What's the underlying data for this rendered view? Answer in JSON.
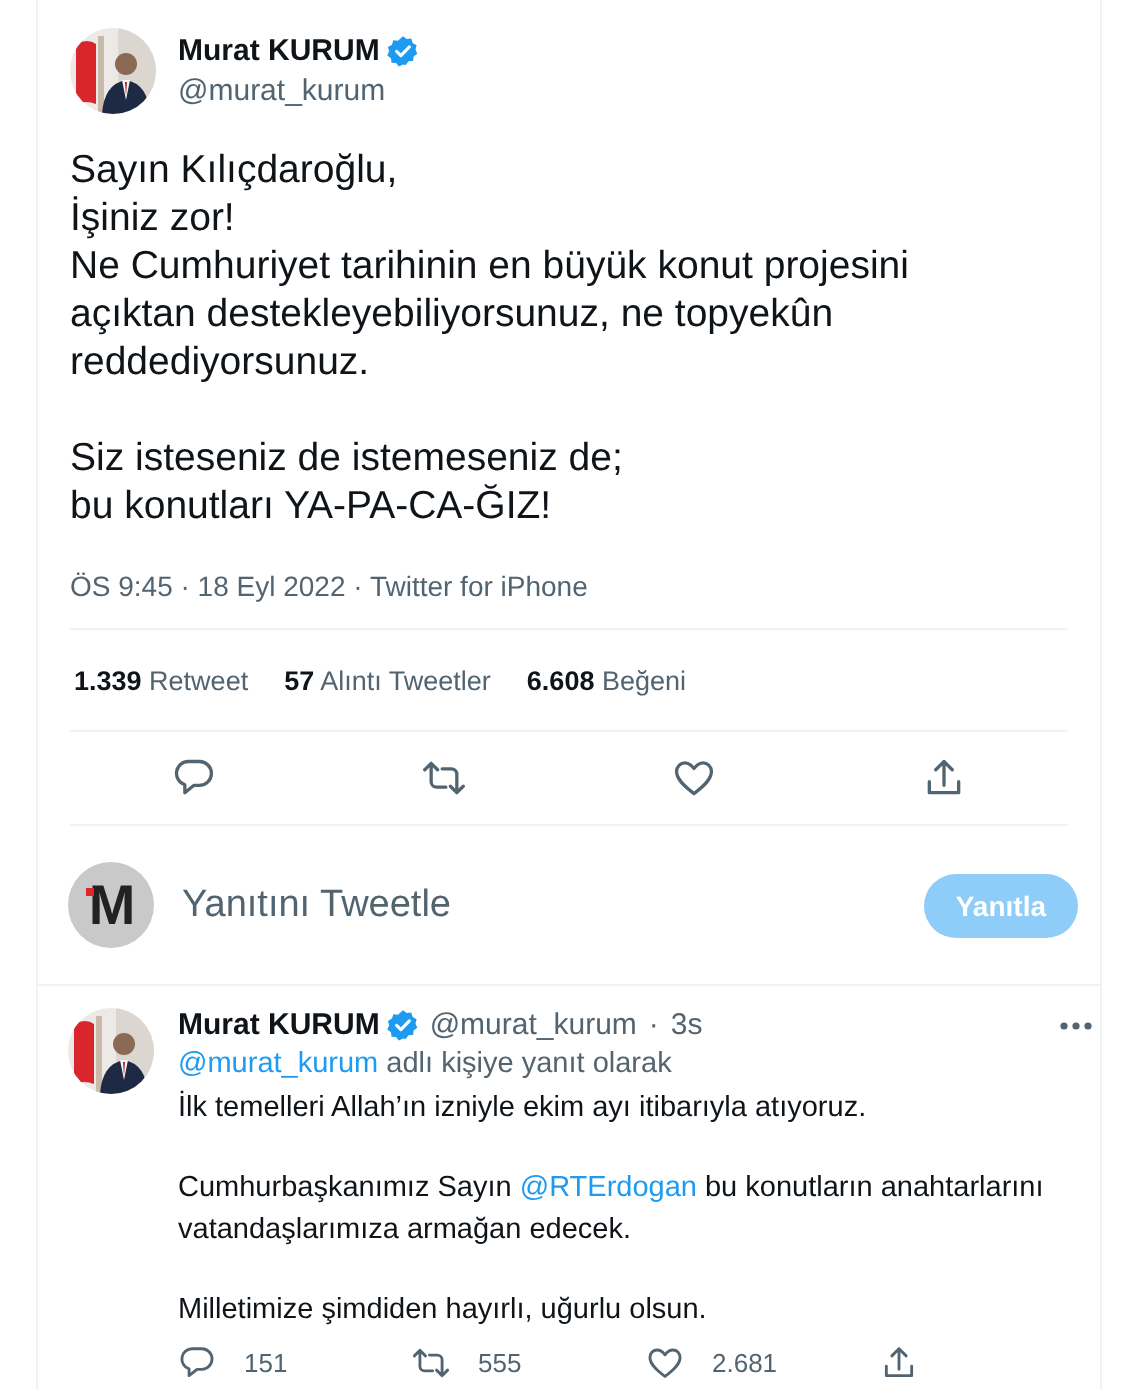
{
  "tweet": {
    "author": {
      "name": "Murat KURUM",
      "handle": "@murat_kurum",
      "verified": true
    },
    "text": "Sayın Kılıçdaroğlu,\nİşiniz zor!\nNe Cumhuriyet tarihinin en büyük konut projesini\naçıktan destekleyebiliyorsunuz, ne topyekûn\nreddediyorsunuz.\n\nSiz isteseniz de istemeseniz de;\nbu konutları YA-PA-CA-ĞIZ!",
    "meta": "ÖS 9:45 · 18 Eyl 2022 · Twitter for iPhone",
    "stats": [
      {
        "count": "1.339",
        "label": "Retweet"
      },
      {
        "count": "57",
        "label": "Alıntı Tweetler"
      },
      {
        "count": "6.608",
        "label": "Beğeni"
      }
    ],
    "actions": [
      {
        "kind": "reply"
      },
      {
        "kind": "retweet"
      },
      {
        "kind": "like"
      },
      {
        "kind": "share"
      }
    ]
  },
  "compose": {
    "logo": "M",
    "placeholder": "Yanıtını Tweetle",
    "button": {
      "label": "Yanıtla",
      "disabled": true
    }
  },
  "reply": {
    "author": {
      "name": "Murat KURUM",
      "handle": "@murat_kurum",
      "verified": true,
      "separator": "·",
      "time": "3s"
    },
    "reply_to": {
      "mention": "@murat_kurum",
      "text": "adlı kişiye yanıt olarak"
    },
    "paragraphs": [
      [
        {
          "text": "İlk temelleri Allah’ın izniyle ekim ayı itibarıyla atıyoruz."
        }
      ],
      [
        {
          "text": "Cumhurbaşkanımız Sayın "
        },
        {
          "text": "@RTErdogan",
          "kind": "mention"
        },
        {
          "text": " bu konutların anahtarlarını\nvatandaşlarımıza armağan edecek."
        }
      ],
      [
        {
          "text": "Milletimize şimdiden hayırlı, uğurlu olsun."
        }
      ]
    ],
    "actions": [
      {
        "kind": "reply",
        "count": "151"
      },
      {
        "kind": "retweet",
        "count": "555"
      },
      {
        "kind": "like",
        "count": "2.681"
      },
      {
        "kind": "share"
      }
    ]
  }
}
